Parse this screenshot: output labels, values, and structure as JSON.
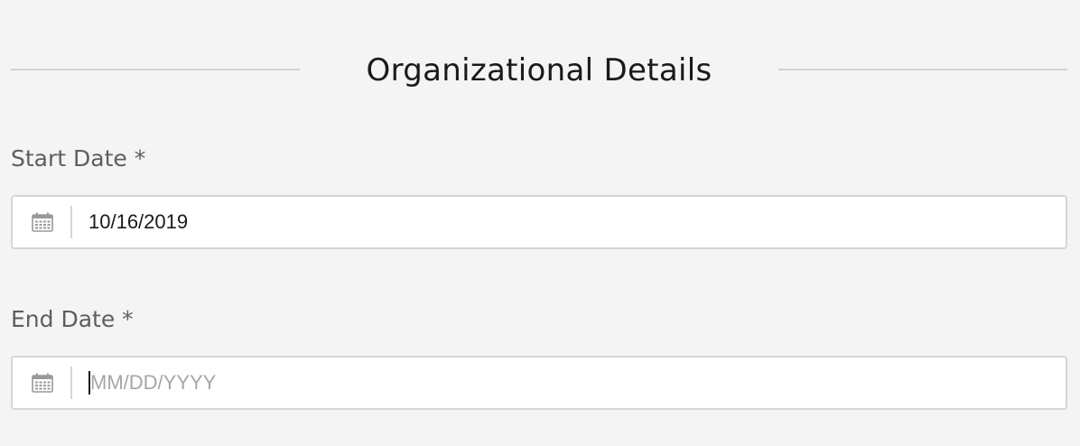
{
  "section": {
    "title": "Organizational Details"
  },
  "start_date": {
    "label": "Start Date *",
    "value": "10/16/2019",
    "icon": "calendar-icon"
  },
  "end_date": {
    "label": "End Date *",
    "value": "",
    "placeholder": "MM/DD/YYYY",
    "icon": "calendar-icon"
  },
  "colors": {
    "background": "#f4f4f4",
    "input_border": "#d6d6d6",
    "label_text": "#5e5e5e",
    "placeholder_text": "#a6a6a6"
  }
}
